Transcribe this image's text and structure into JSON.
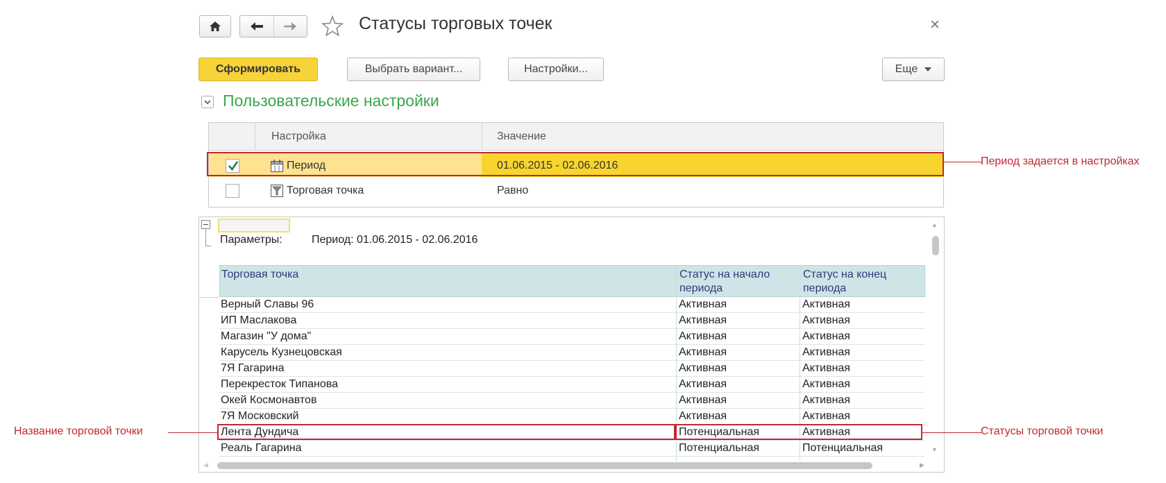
{
  "window": {
    "title": "Статусы торговых точек",
    "close_glyph": "×"
  },
  "toolbar": {
    "generate": "Сформировать",
    "choose_variant": "Выбрать вариант...",
    "settings": "Настройки...",
    "more": "Еще"
  },
  "user_settings": {
    "title": "Пользовательские настройки",
    "col_setting": "Настройка",
    "col_value": "Значение",
    "rows": [
      {
        "checked": true,
        "name": "Период",
        "value": "01.06.2015 - 02.06.2016"
      },
      {
        "checked": false,
        "name": "Торговая точка",
        "value": "Равно"
      }
    ]
  },
  "report": {
    "params_label": "Параметры:",
    "params_value": "Период: 01.06.2015 - 02.06.2016",
    "columns": [
      "Торговая точка",
      "Статус на начало периода",
      "Статус на конец периода"
    ],
    "col_start_line1": "Статус на начало",
    "col_start_line2": "периода",
    "col_end_line1": "Статус на конец",
    "col_end_line2": "периода",
    "rows": [
      {
        "point": "Верный Славы 96",
        "start": "Активная",
        "end": "Активная"
      },
      {
        "point": "ИП Маслакова",
        "start": "Активная",
        "end": "Активная"
      },
      {
        "point": "Магазин \"У дома\"",
        "start": "Активная",
        "end": "Активная"
      },
      {
        "point": "Карусель Кузнецовская",
        "start": "Активная",
        "end": "Активная"
      },
      {
        "point": "7Я Гагарина",
        "start": "Активная",
        "end": "Активная"
      },
      {
        "point": "Перекресток Типанова",
        "start": "Активная",
        "end": "Активная"
      },
      {
        "point": "Окей Космонавтов",
        "start": "Активная",
        "end": "Активная"
      },
      {
        "point": "7Я Московский",
        "start": "Активная",
        "end": "Активная"
      },
      {
        "point": "Лента Дундича",
        "start": "Потенциальная",
        "end": "Активная"
      },
      {
        "point": "Реаль Гагарина",
        "start": "Потенциальная",
        "end": "Потенциальная"
      }
    ]
  },
  "annotations": {
    "period": "Период задается в настройках",
    "point_name": "Название торговой точки",
    "statuses": "Статусы торговой точки"
  },
  "colors": {
    "primary_button": "#f7d33a",
    "selected_row": "#fde38f",
    "selected_value": "#f8d52e",
    "section_title": "#3aa64c",
    "report_header": "#cfe4e6",
    "annotation": "#c0282f"
  },
  "icons": [
    "home-icon",
    "arrow-left-icon",
    "arrow-right-icon",
    "star-icon",
    "close-icon",
    "chevron-down-icon",
    "calendar-icon",
    "filter-icon",
    "collapse-icon"
  ]
}
